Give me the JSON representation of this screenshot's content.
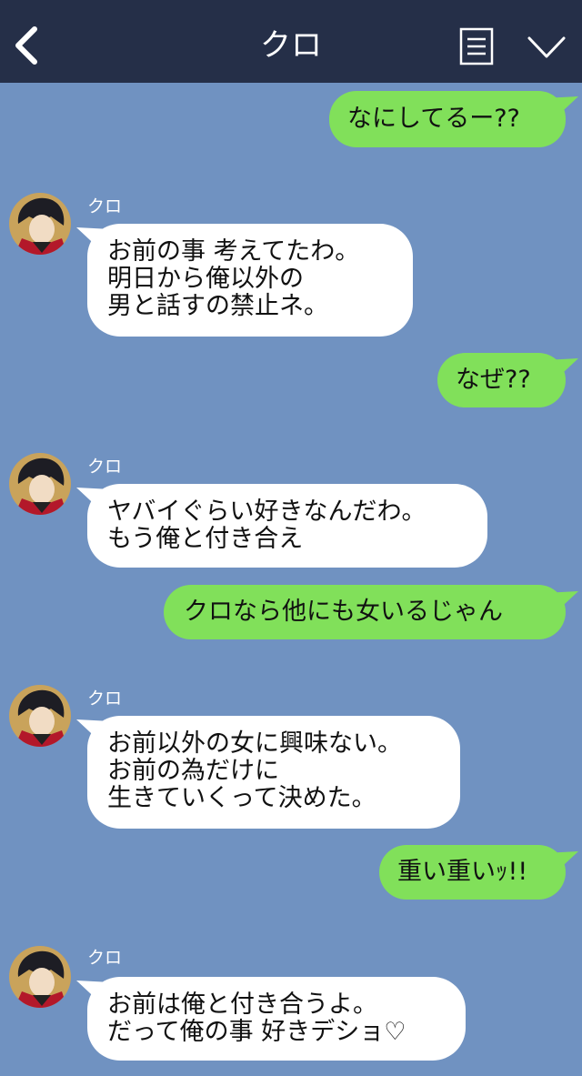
{
  "header": {
    "title": "クロ",
    "back_icon": "chevron-left-icon",
    "menu_icon": "menu-list-icon",
    "collapse_icon": "chevron-down-icon",
    "bg_color": "#252f48"
  },
  "chat": {
    "bg_color": "#7092c1",
    "sent_color": "#81e05a",
    "recv_color": "#ffffff",
    "messages": [
      {
        "from": "me",
        "text": "なにしてるー??"
      },
      {
        "from": "クロ",
        "text": "お前の事 考えてたわ。\n明日から俺以外の\n男と話すの禁止ネ。"
      },
      {
        "from": "me",
        "text": "なぜ??"
      },
      {
        "from": "クロ",
        "text": "ヤバイぐらい好きなんだわ。\nもう俺と付き合え"
      },
      {
        "from": "me",
        "text": "クロなら他にも女いるじゃん"
      },
      {
        "from": "クロ",
        "text": "お前以外の女に興味ない。\nお前の為だけに\n生きていくって決めた。"
      },
      {
        "from": "me",
        "text": "重い重いｯ!!"
      },
      {
        "from": "クロ",
        "text": "お前は俺と付き合うよ。\nだって俺の事 好きデショ♡"
      }
    ]
  }
}
